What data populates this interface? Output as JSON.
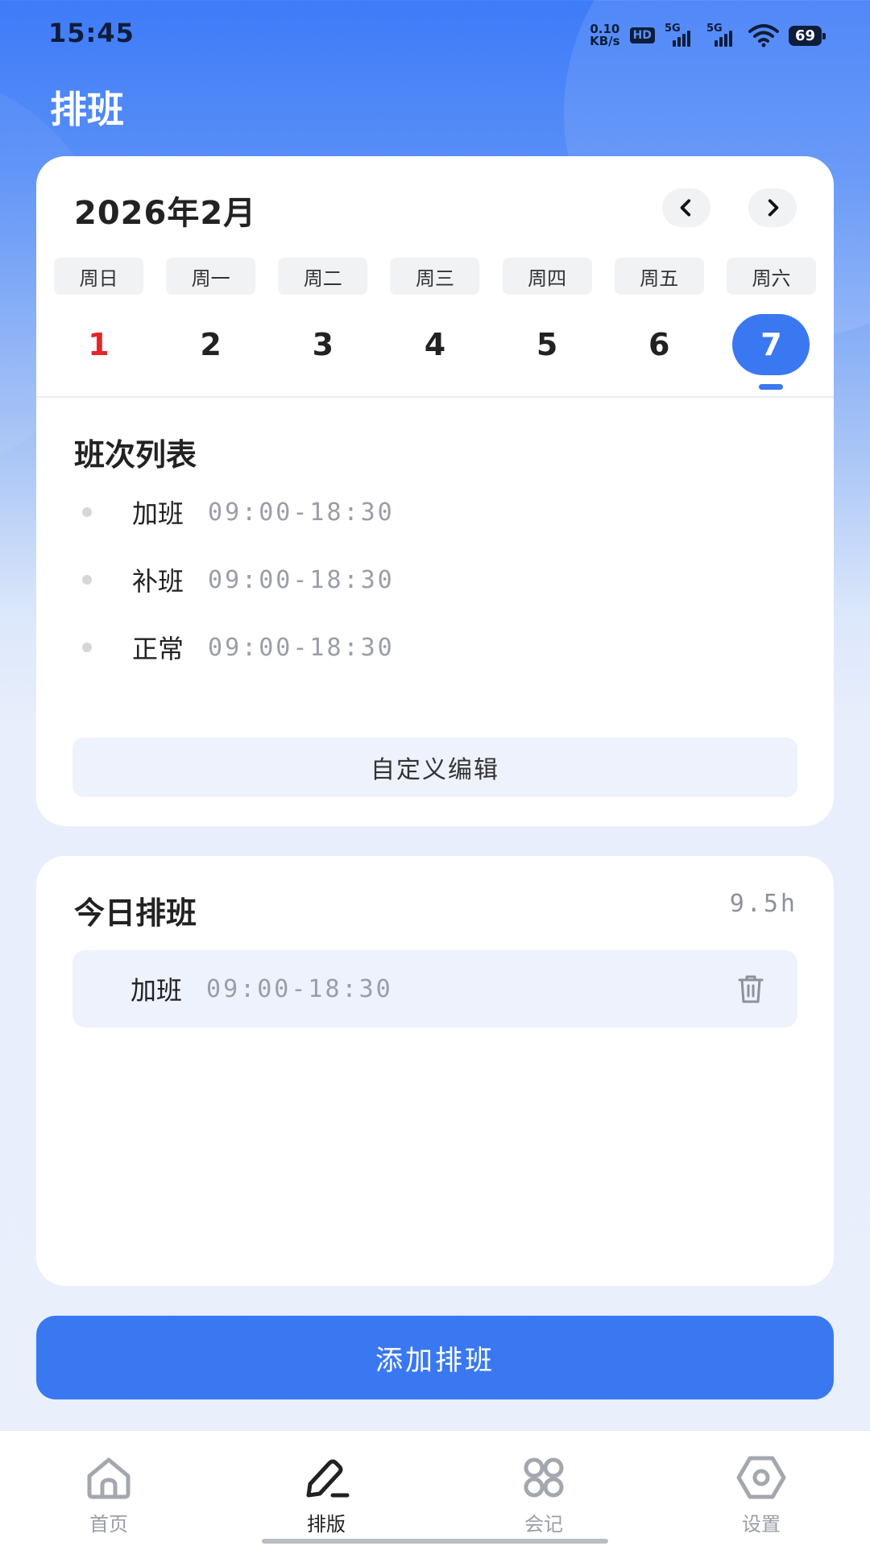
{
  "status_bar": {
    "time": "15:45",
    "net_speed_value": "0.10",
    "net_speed_unit": "KB/s",
    "hd": "HD",
    "hd_sub": "1 2",
    "sim1": "5G",
    "sim2": "5G",
    "battery": "69"
  },
  "page": {
    "title": "排班"
  },
  "calendar": {
    "month_title": "2026年2月",
    "weekdays": [
      "周日",
      "周一",
      "周二",
      "周三",
      "周四",
      "周五",
      "周六"
    ],
    "dates": [
      "1",
      "2",
      "3",
      "4",
      "5",
      "6",
      "7"
    ],
    "selected_date": "7"
  },
  "shift_list": {
    "title": "班次列表",
    "items": [
      {
        "name": "加班",
        "time": "09:00-18:30"
      },
      {
        "name": "补班",
        "time": "09:00-18:30"
      },
      {
        "name": "正常",
        "time": "09:00-18:30"
      }
    ],
    "edit_button": "自定义编辑"
  },
  "today": {
    "title": "今日排班",
    "hours": "9.5h",
    "items": [
      {
        "name": "加班",
        "time": "09:00-18:30"
      }
    ]
  },
  "add_button": "添加排班",
  "tabs": [
    {
      "label": "首页",
      "icon": "home-icon"
    },
    {
      "label": "排版",
      "icon": "edit-icon",
      "active": true
    },
    {
      "label": "会记",
      "icon": "apps-icon"
    },
    {
      "label": "设置",
      "icon": "settings-icon"
    }
  ],
  "colors": {
    "accent": "#3a78f2",
    "sunday": "#e5252a",
    "muted": "#9a9ea6"
  }
}
